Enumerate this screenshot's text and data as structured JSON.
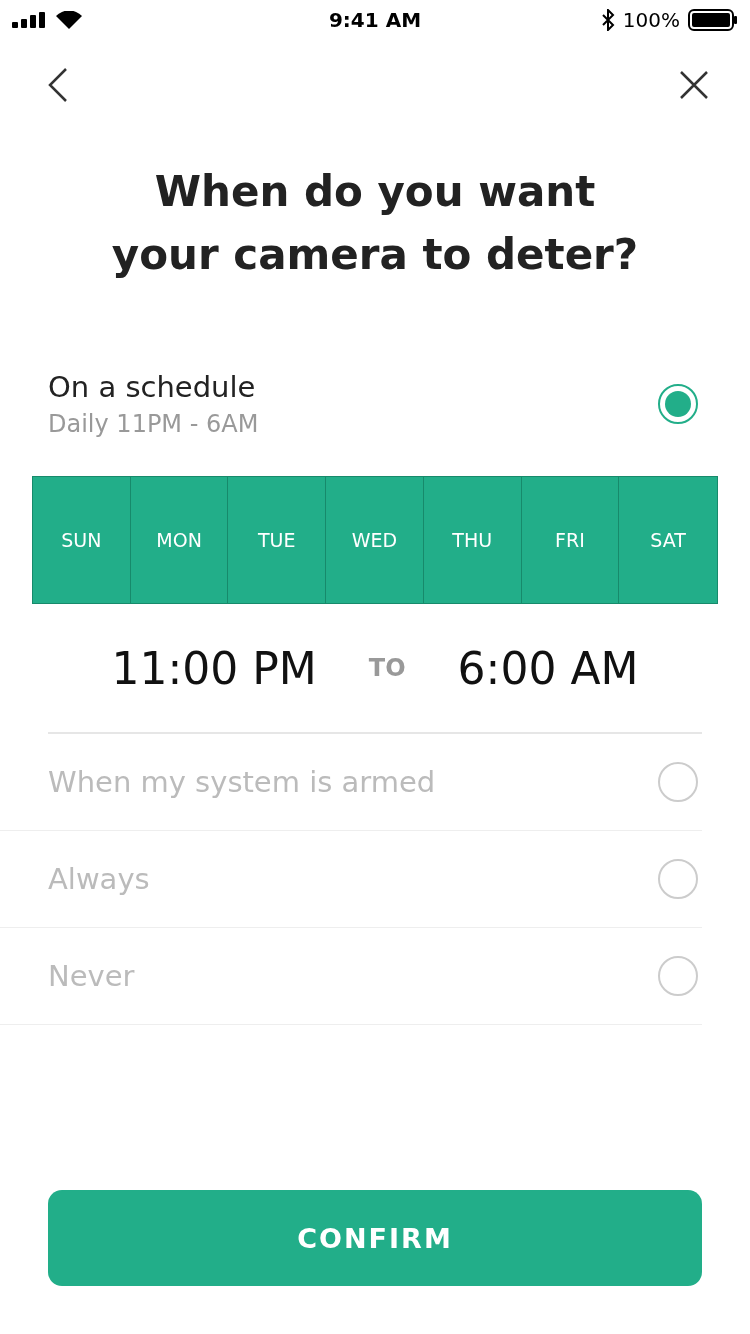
{
  "status_bar": {
    "time": "9:41 AM",
    "battery": "100%"
  },
  "title": "When do you want\nyour camera to deter?",
  "schedule": {
    "label": "On a schedule",
    "subtitle": "Daily 11PM - 6AM",
    "selected": true,
    "days": [
      {
        "label": "SUN",
        "selected": true
      },
      {
        "label": "MON",
        "selected": true
      },
      {
        "label": "TUE",
        "selected": true
      },
      {
        "label": "WED",
        "selected": true
      },
      {
        "label": "THU",
        "selected": true
      },
      {
        "label": "FRI",
        "selected": true
      },
      {
        "label": "SAT",
        "selected": true
      }
    ],
    "start": "11:00 PM",
    "separator": "TO",
    "end": "6:00 AM"
  },
  "options": [
    {
      "label": "When my system is armed",
      "selected": false
    },
    {
      "label": "Always",
      "selected": false
    },
    {
      "label": "Never",
      "selected": false
    }
  ],
  "confirm": "CONFIRM"
}
